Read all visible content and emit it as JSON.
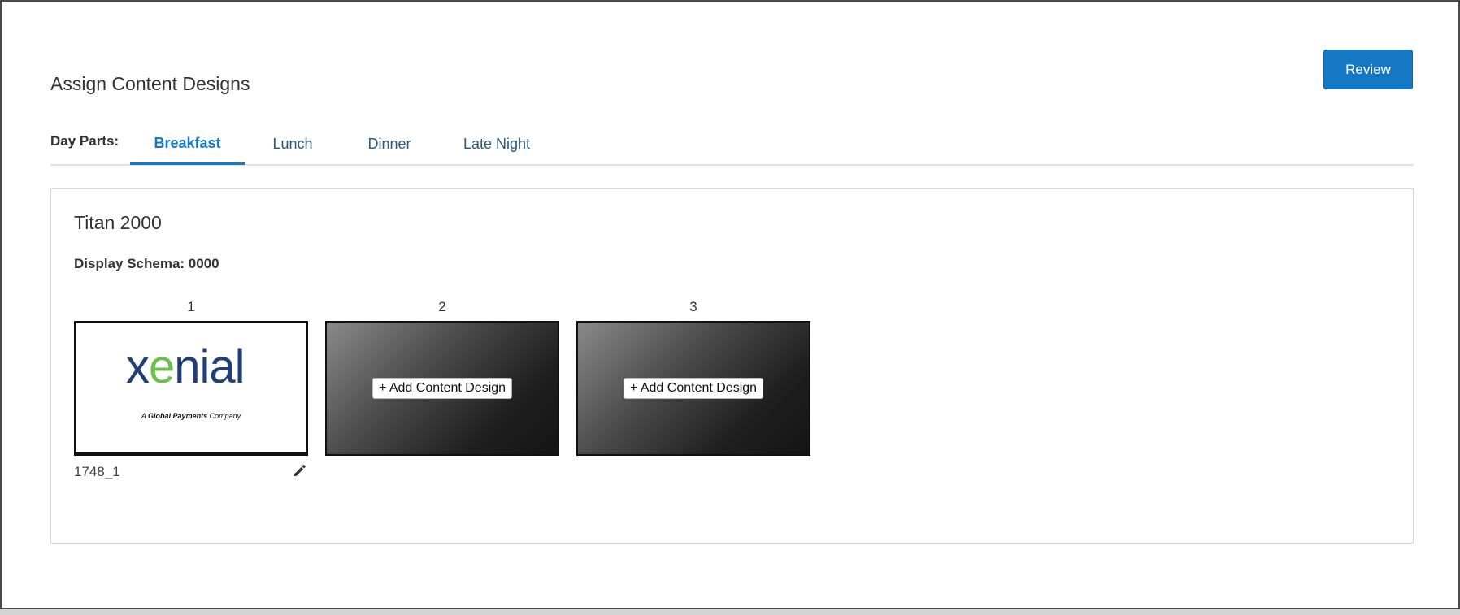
{
  "page": {
    "title": "Assign Content Designs",
    "review_label": "Review"
  },
  "day_parts": {
    "label": "Day Parts:",
    "tabs": [
      {
        "label": "Breakfast",
        "active": true
      },
      {
        "label": "Lunch",
        "active": false
      },
      {
        "label": "Dinner",
        "active": false
      },
      {
        "label": "Late Night",
        "active": false
      }
    ]
  },
  "device": {
    "name": "Titan 2000",
    "schema_label": "Display Schema: 0000",
    "slots": [
      {
        "number": "1",
        "filled": true,
        "logo_text_part1": "x",
        "logo_text_accent": "e",
        "logo_text_part2": "nial",
        "tagline_prefix": "A ",
        "tagline_bold": "Global Payments",
        "tagline_suffix": " Company",
        "caption": "1748_1",
        "edit_icon": "pencil-icon"
      },
      {
        "number": "2",
        "filled": false,
        "add_label": "+ Add Content Design"
      },
      {
        "number": "3",
        "filled": false,
        "add_label": "+ Add Content Design"
      }
    ]
  },
  "colors": {
    "accent": "#1478c4",
    "tab_text": "#2a5a80",
    "logo_blue": "#1f3f76",
    "logo_green": "#6cc04a"
  }
}
